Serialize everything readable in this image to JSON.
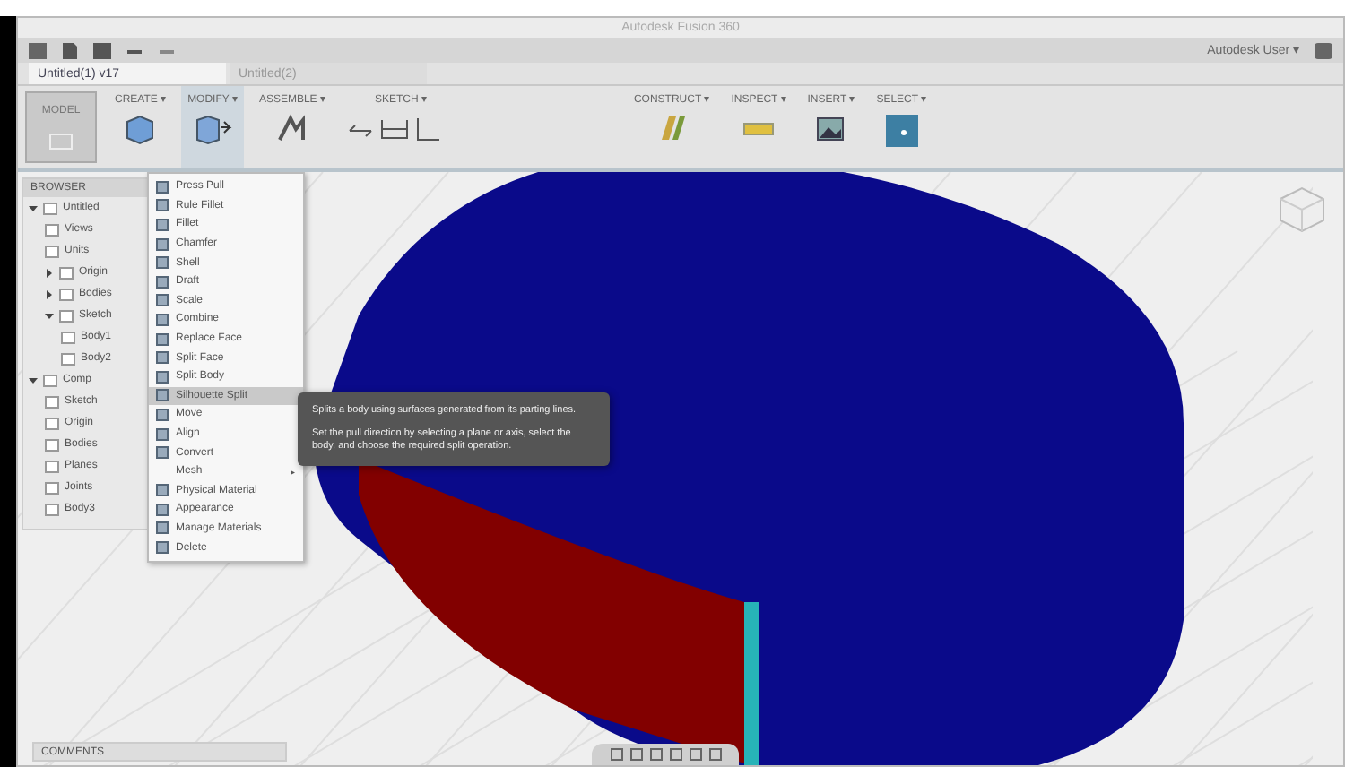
{
  "window": {
    "title": "Autodesk Fusion 360",
    "user": "Autodesk User ▾"
  },
  "document_tabs": [
    {
      "label": "Untitled(1) v17",
      "selected": true
    },
    {
      "label": "Untitled(2)",
      "selected": false
    }
  ],
  "workspace": {
    "label": "MODEL"
  },
  "ribbon_tabs": [
    {
      "label": "CREATE ▾",
      "selected": false,
      "kind": "box"
    },
    {
      "label": "MODIFY ▾",
      "selected": true,
      "kind": "pull"
    },
    {
      "label": "ASSEMBLE ▾",
      "selected": false,
      "kind": "joint"
    },
    {
      "label": "SKETCH ▾",
      "selected": false,
      "kind": "sketch"
    },
    {
      "label": "CONSTRUCT ▾",
      "selected": false,
      "kind": "plane"
    },
    {
      "label": "INSPECT ▾",
      "selected": false,
      "kind": "measure"
    },
    {
      "label": "INSERT ▾",
      "selected": false,
      "kind": "image"
    },
    {
      "label": "SELECT ▾",
      "selected": false,
      "kind": "select"
    }
  ],
  "browser": {
    "title": "BROWSER",
    "items": [
      {
        "label": "Untitled",
        "expanded": true,
        "children": [
          {
            "label": "Views"
          },
          {
            "label": "Units"
          },
          {
            "label": "Origin",
            "expanded": false
          },
          {
            "label": "Bodies",
            "expanded": false
          },
          {
            "label": "Sketch",
            "expanded": true,
            "children": [
              {
                "label": "Body1"
              },
              {
                "label": "Body2"
              }
            ]
          }
        ]
      },
      {
        "label": "Comp",
        "expanded": true,
        "children": [
          {
            "label": "Sketch"
          },
          {
            "label": "Origin"
          },
          {
            "label": "Bodies"
          },
          {
            "label": "Planes"
          },
          {
            "label": "Joints"
          },
          {
            "label": "Body3"
          }
        ]
      }
    ]
  },
  "modify_menu": {
    "items": [
      {
        "label": "Press Pull",
        "kind": "item",
        "highlighted": false
      },
      {
        "label": "Rule Fillet",
        "kind": "item",
        "highlighted": false
      },
      {
        "label": "Fillet",
        "kind": "item",
        "highlighted": false
      },
      {
        "label": "Chamfer",
        "kind": "item",
        "highlighted": false
      },
      {
        "label": "Shell",
        "kind": "item",
        "highlighted": false
      },
      {
        "label": "Draft",
        "kind": "item",
        "highlighted": false
      },
      {
        "label": "Scale",
        "kind": "item",
        "highlighted": false
      },
      {
        "label": "Combine",
        "kind": "item",
        "highlighted": false
      },
      {
        "label": "Replace Face",
        "kind": "item",
        "highlighted": false
      },
      {
        "label": "Split Face",
        "kind": "item",
        "highlighted": false
      },
      {
        "label": "Split Body",
        "kind": "item",
        "highlighted": false
      },
      {
        "label": "Silhouette Split",
        "kind": "item",
        "highlighted": true
      },
      {
        "label": "Move",
        "kind": "item",
        "highlighted": false
      },
      {
        "label": "Align",
        "kind": "item",
        "highlighted": false
      },
      {
        "label": "Convert",
        "kind": "item",
        "highlighted": false
      },
      {
        "label": "Mesh",
        "kind": "submenu",
        "arrow": "▸",
        "highlighted": false
      },
      {
        "label": "Physical Material",
        "kind": "item",
        "highlighted": false
      },
      {
        "label": "Appearance",
        "kind": "item",
        "highlighted": false
      },
      {
        "label": "Manage Materials",
        "kind": "item",
        "highlighted": false
      },
      {
        "label": "Delete",
        "kind": "item",
        "highlighted": false
      }
    ]
  },
  "tooltip": {
    "paragraphs": [
      "Splits a body using surfaces generated from its parting lines.",
      "Set the pull direction by selecting a plane or axis, select the body, and choose the required split operation."
    ]
  },
  "comments": {
    "label": "COMMENTS"
  }
}
